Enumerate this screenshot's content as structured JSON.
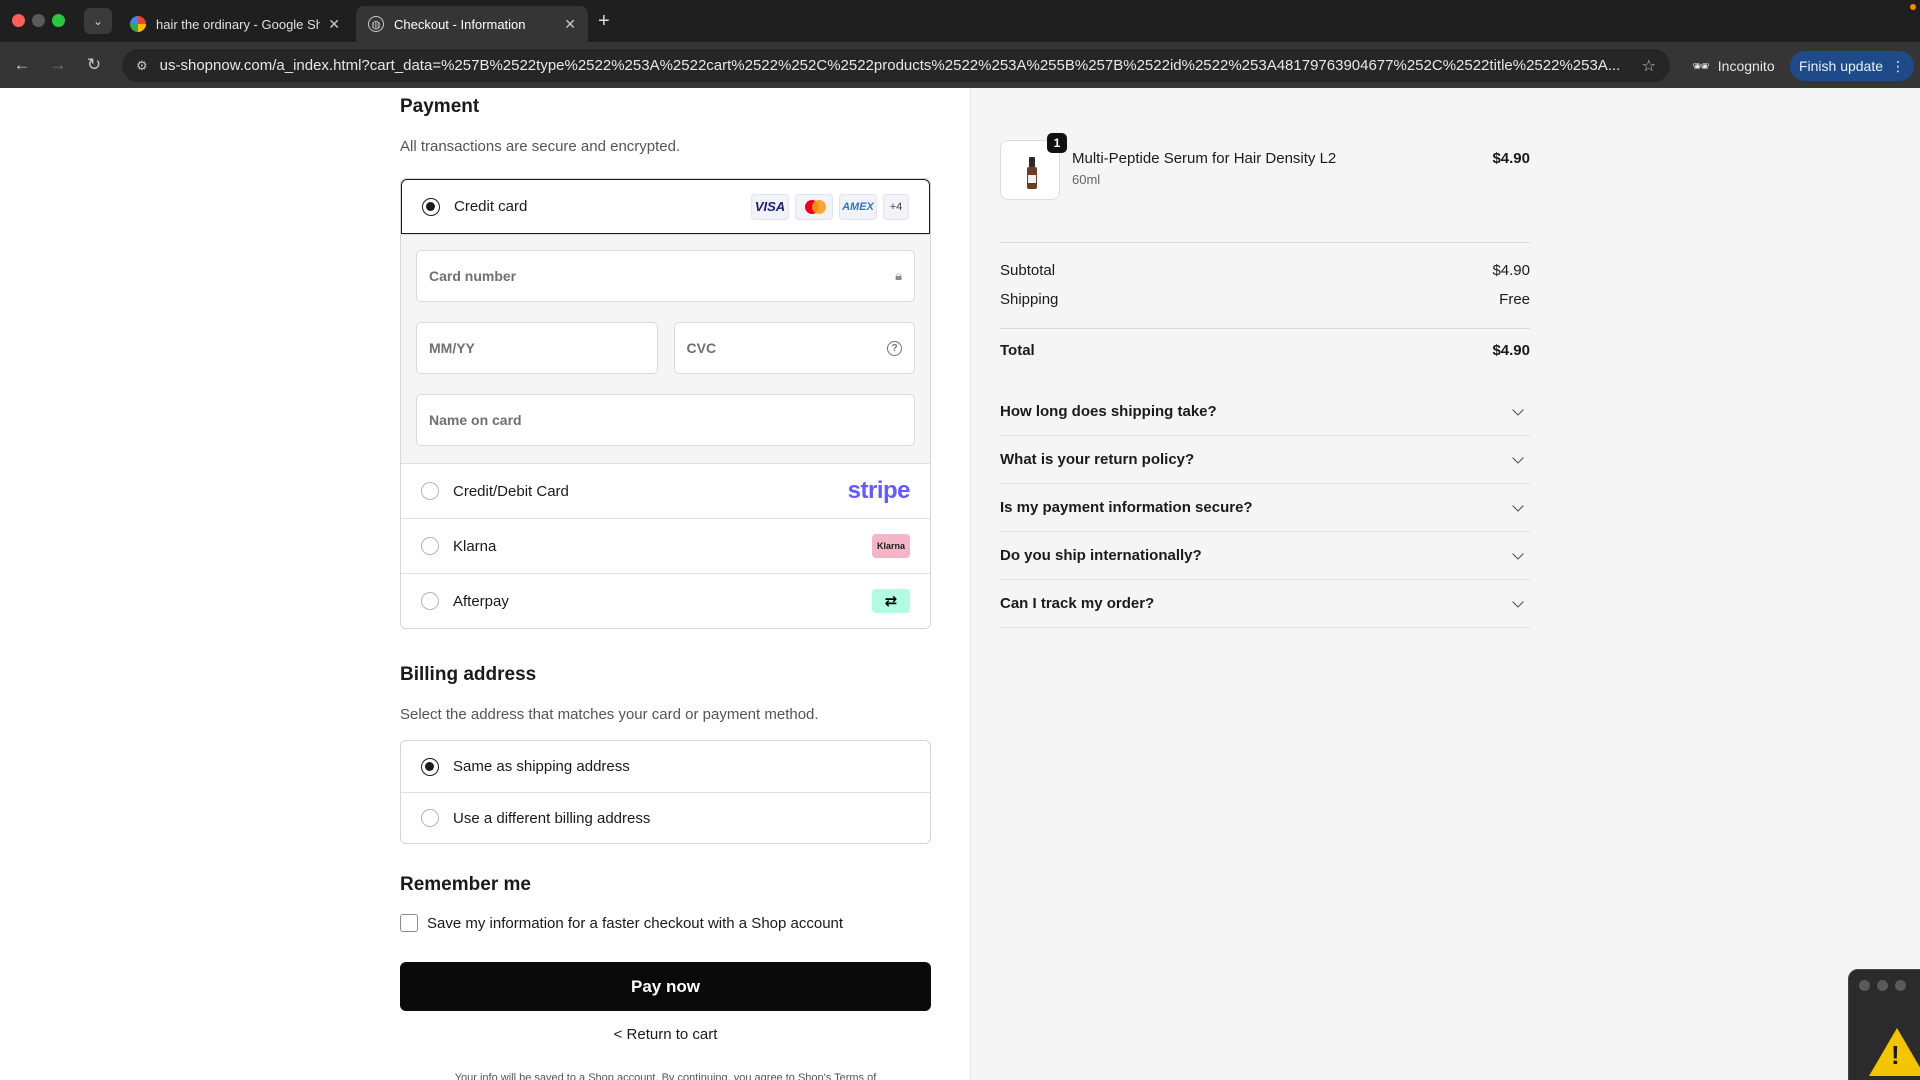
{
  "browser": {
    "tabs": [
      {
        "title": "hair the ordinary - Google Sh",
        "icon": "google-icon"
      },
      {
        "title": "Checkout - Information",
        "icon": "globe-icon"
      }
    ],
    "url": "us-shopnow.com/a_index.html?cart_data=%257B%2522type%2522%253A%2522cart%2522%252C%2522products%2522%253A%255B%257B%2522id%2522%253A48179763904677%252C%2522title%2522%253A...",
    "incognito_label": "Incognito",
    "finish_update_label": "Finish update"
  },
  "payment": {
    "title": "Payment",
    "subtitle": "All transactions are secure and encrypted.",
    "credit_card_label": "Credit card",
    "card_brands": [
      "VISA",
      "AMEX",
      "+4"
    ],
    "card_number_placeholder": "Card number",
    "expiry_placeholder": "MM/YY",
    "cvc_placeholder": "CVC",
    "name_placeholder": "Name on card",
    "other_options": [
      {
        "label": "Credit/Debit Card",
        "logo": "stripe"
      },
      {
        "label": "Klarna",
        "logo": "Klarna"
      },
      {
        "label": "Afterpay",
        "logo": "afterpay-icon"
      }
    ]
  },
  "billing": {
    "title": "Billing address",
    "subtitle": "Select the address that matches your card or payment method.",
    "options": [
      "Same as shipping address",
      "Use a different billing address"
    ]
  },
  "remember": {
    "title": "Remember me",
    "checkbox_label": "Save my information for a faster checkout with a Shop account"
  },
  "actions": {
    "pay_now": "Pay now",
    "return_to_cart": "< Return to cart",
    "legal_text": "Your info will be saved to a Shop account. By continuing, you agree to Shop's Terms of"
  },
  "summary": {
    "product": {
      "name": "Multi-Peptide Serum for Hair Density L2",
      "variant": "60ml",
      "price": "$4.90",
      "quantity": "1"
    },
    "subtotal_label": "Subtotal",
    "subtotal_value": "$4.90",
    "shipping_label": "Shipping",
    "shipping_value": "Free",
    "total_label": "Total",
    "total_value": "$4.90",
    "faqs": [
      "How long does shipping take?",
      "What is your return policy?",
      "Is my payment information secure?",
      "Do you ship internationally?",
      "Can I track my order?"
    ]
  }
}
